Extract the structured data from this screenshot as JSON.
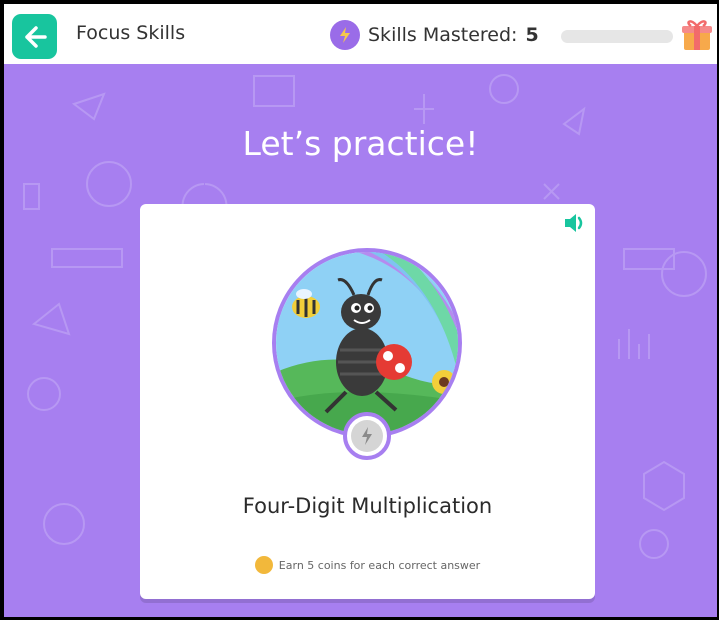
{
  "header": {
    "title": "Focus Skills",
    "mastered_label": "Skills Mastered:",
    "mastered_count": "5",
    "progress_fraction": 0
  },
  "main": {
    "headline": "Let’s practice!",
    "skill_name": "Four-Digit Multiplication",
    "coins_note": "Earn 5 coins for each correct answer"
  },
  "icons": {
    "back": "arrow-left-icon",
    "bolt": "lightning-bolt-icon",
    "gift": "gift-icon",
    "sound": "speaker-icon",
    "coin": "coin-icon"
  },
  "colors": {
    "accent_teal": "#18c59e",
    "background_purple": "#a77ff0",
    "badge_purple": "#9a6ce8"
  }
}
